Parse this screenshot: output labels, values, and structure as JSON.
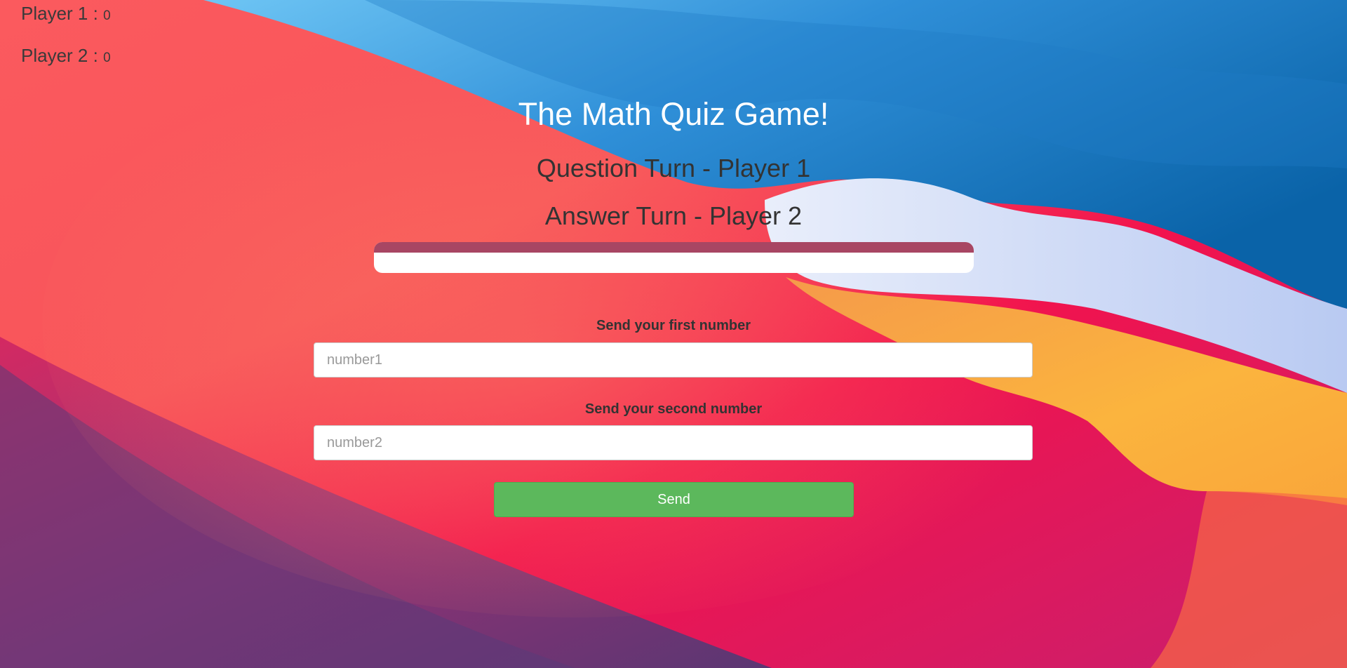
{
  "scores": {
    "player1": {
      "label": "Player 1 : ",
      "value": "0"
    },
    "player2": {
      "label": "Player 2 : ",
      "value": "0"
    }
  },
  "title": "The Math Quiz Game!",
  "question_turn": "Question Turn - Player 1",
  "answer_turn": "Answer Turn - Player 2",
  "timer_progress": 1.0,
  "form": {
    "first_label": "Send your first number",
    "first_placeholder": "number1",
    "first_value": "",
    "second_label": "Send your second number",
    "second_placeholder": "number2",
    "second_value": "",
    "send_label": "Send"
  },
  "colors": {
    "title": "#ffffff",
    "progress_fill": "#a84663",
    "send_button": "#5cb85c"
  }
}
